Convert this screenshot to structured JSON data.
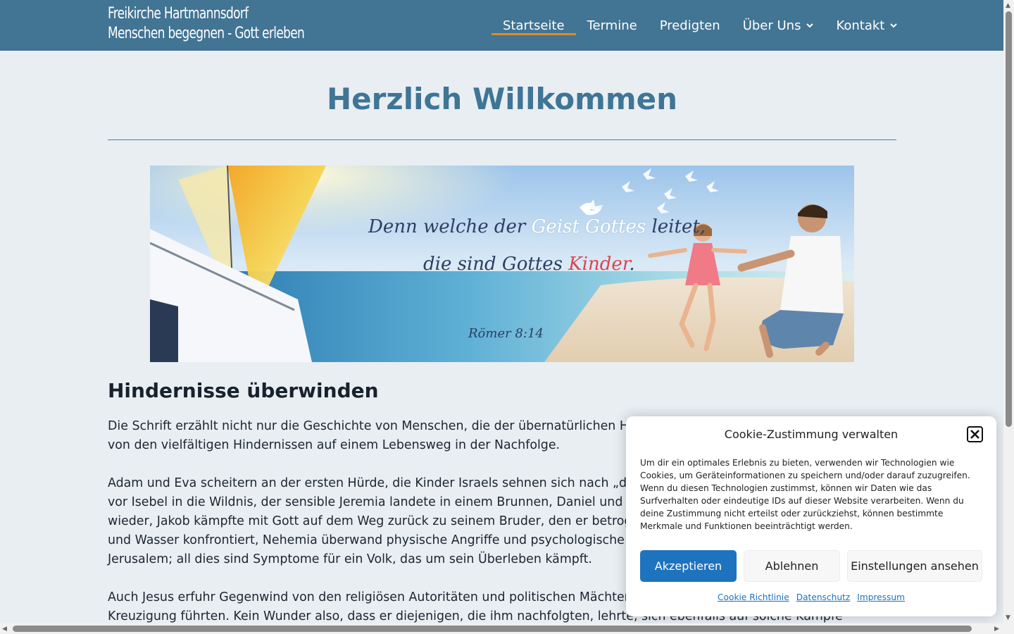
{
  "header": {
    "logo_line1": "Freikirche Hartmannsdorf",
    "logo_line2": "Menschen begegnen - Gott erleben",
    "nav": [
      {
        "label": "Startseite",
        "active": true
      },
      {
        "label": "Termine"
      },
      {
        "label": "Predigten"
      },
      {
        "label": "Über Uns",
        "has_dropdown": true
      },
      {
        "label": "Kontakt",
        "has_dropdown": true
      }
    ],
    "colors": {
      "bar": "#427493",
      "active_underline": "#e0892a"
    }
  },
  "main": {
    "title": "Herzlich Willkommen",
    "banner": {
      "verse_part1": "Denn welche der ",
      "verse_highlight1": "Geist Gottes",
      "verse_part2": " leitet,",
      "verse_line2_a": "die sind Gottes ",
      "verse_line2_highlight": "Kinder",
      "verse_line2_end": ".",
      "reference": "Römer 8:14"
    },
    "section_heading": "Hindernisse überwinden",
    "paragraphs": [
      "Die Schrift erzählt nicht nur die Geschichte von Menschen, die der übernatürlichen Hei",
      "von den vielfältigen Hindernissen auf einem Lebensweg in der Nachfolge.",
      "Adam und Eva scheitern an der ersten Hürde, die Kinder Israels sehnen sich nach „den",
      "vor Isebel in die Wildnis, der sensible Jeremia landete in einem Brunnen, Daniel und se",
      "wieder, Jakob kämpfte mit Gott auf dem Weg zurück zu seinem Bruder, den er betroge",
      "und Wasser konfrontiert, Nehemia überwand physische Angriffe und psychologische K",
      "Jerusalem; all dies sind Symptome für ein Volk, das um sein Überleben kämpft.",
      "Auch Jesus erfuhr Gegenwind von den religiösen Autoritäten und politischen Mächten,",
      "Kreuzigung führten. Kein Wunder also, dass er diejenigen, die ihm nachfolgten, lehrte, sich ebenfalls auf solche Kämpfe"
    ]
  },
  "cookie": {
    "title": "Cookie-Zustimmung verwalten",
    "text": "Um dir ein optimales Erlebnis zu bieten, verwenden wir Technologien wie Cookies, um Geräteinformationen zu speichern und/oder darauf zuzugreifen. Wenn du diesen Technologien zustimmst, können wir Daten wie das Surfverhalten oder eindeutige IDs auf dieser Website verarbeiten. Wenn du deine Zustimmung nicht erteilst oder zurückziehst, können bestimmte Merkmale und Funktionen beeinträchtigt werden.",
    "accept": "Akzeptieren",
    "deny": "Ablehnen",
    "settings": "Einstellungen ansehen",
    "links": [
      "Cookie Richtlinie",
      "Datenschutz",
      "Impressum"
    ],
    "accent": "#1e73be"
  }
}
